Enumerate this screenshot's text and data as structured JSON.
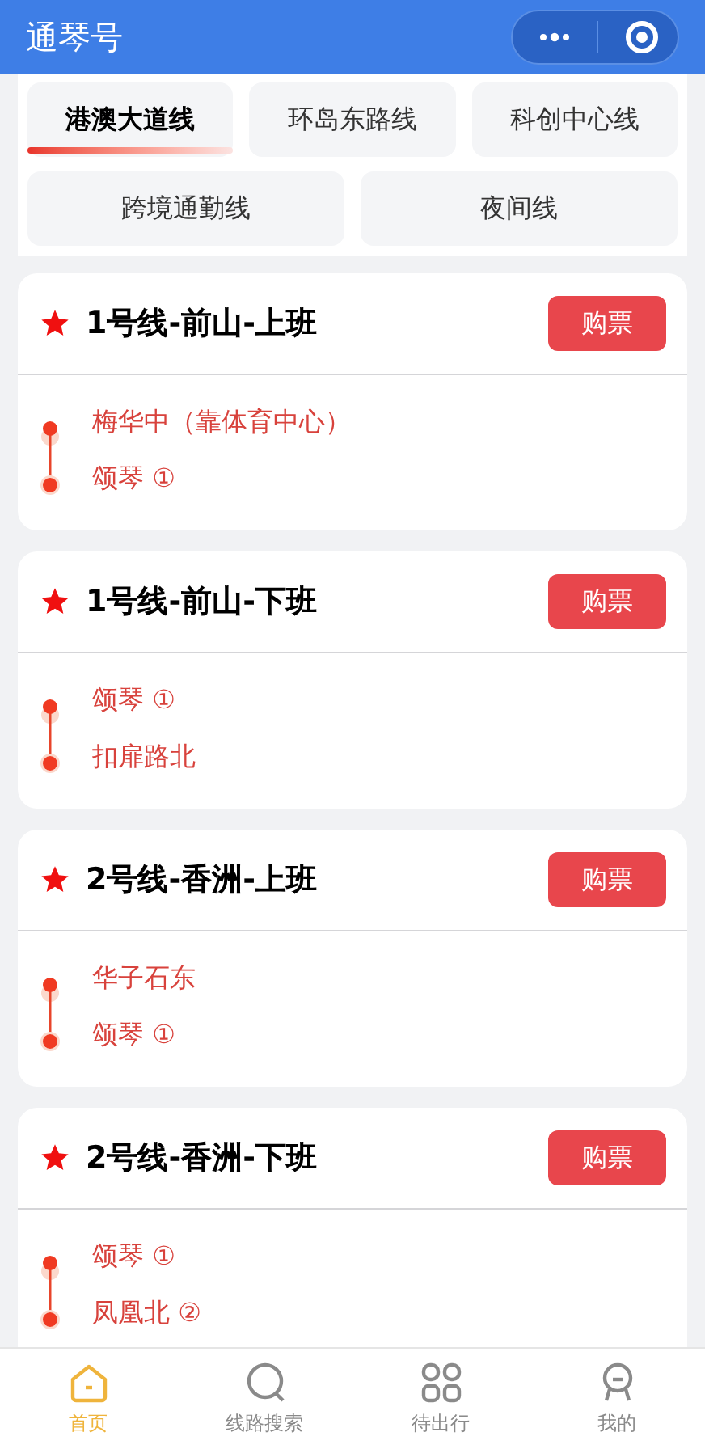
{
  "title": "通琴号",
  "line_tabs": [
    {
      "label": "港澳大道线",
      "selected": true
    },
    {
      "label": "环岛东路线",
      "selected": false
    },
    {
      "label": "科创中心线",
      "selected": false
    },
    {
      "label": "跨境通勤线",
      "selected": false
    },
    {
      "label": "夜间线",
      "selected": false
    }
  ],
  "routes": [
    {
      "name": "1号线-前山-上班",
      "starred": true,
      "button": "购票",
      "stops": [
        "梅华中（靠体育中心）",
        "颂琴 ①"
      ]
    },
    {
      "name": "1号线-前山-下班",
      "starred": true,
      "button": "购票",
      "stops": [
        "颂琴 ①",
        "扣扉路北"
      ]
    },
    {
      "name": "2号线-香洲-上班",
      "starred": true,
      "button": "购票",
      "stops": [
        "华子石东",
        "颂琴 ①"
      ]
    },
    {
      "name": "2号线-香洲-下班",
      "starred": true,
      "button": "购票",
      "stops": [
        "颂琴 ①",
        "凤凰北 ②"
      ]
    }
  ],
  "tab_bar": [
    {
      "label": "首页",
      "kind": "home",
      "selected": true
    },
    {
      "label": "线路搜索",
      "kind": "search",
      "selected": false
    },
    {
      "label": "待出行",
      "kind": "grid",
      "selected": false
    },
    {
      "label": "我的",
      "kind": "profile",
      "selected": false
    }
  ]
}
